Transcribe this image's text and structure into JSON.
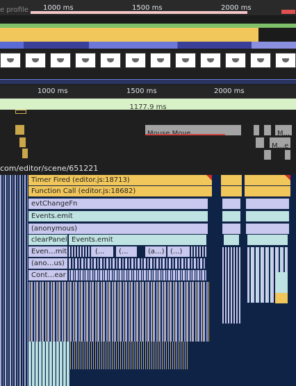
{
  "overview": {
    "label_partial": "e profile",
    "ticks": [
      "1000 ms",
      "1500 ms",
      "2000 ms"
    ]
  },
  "timeline": {
    "ticks": [
      "1000 ms",
      "1500 ms",
      "2000 ms"
    ],
    "selection_duration": "1177.9 ms"
  },
  "interactions": {
    "mouse_move": "Mouse Move",
    "m_short": "M...",
    "m_e": "M...e"
  },
  "main_thread": {
    "url_partial": "com/editor/scene/651221"
  },
  "flame": {
    "rows": [
      [
        "Timer Fired (editor.js:18713)"
      ],
      [
        "Function Call (editor.js:18682)"
      ],
      [
        "evtChangeFn"
      ],
      [
        "Events.emit"
      ],
      [
        "(anonymous)"
      ],
      [
        "clearPanel",
        "Events.emit"
      ],
      [
        "Even…mit",
        "(...",
        "(...",
        "(a...)",
        "(...)"
      ],
      [
        "(ano…us)"
      ],
      [
        "Cont…ear"
      ]
    ]
  },
  "colors": {
    "timer": "#f1c65a",
    "lavender": "#c9c8ef",
    "teal": "#bfe3e3",
    "navy": "#0f2347",
    "selection": "#d8f1c6"
  }
}
